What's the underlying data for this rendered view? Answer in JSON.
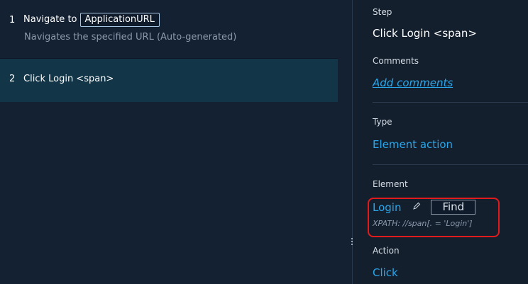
{
  "steps": [
    {
      "number": "1",
      "title": "Navigate to",
      "param": "ApplicationURL",
      "description": "Navigates the specified URL (Auto-generated)"
    },
    {
      "number": "2",
      "title": "Click Login <span>"
    }
  ],
  "details": {
    "step_label": "Step",
    "step_value": "Click Login <span>",
    "comments_label": "Comments",
    "comments_link": "Add comments",
    "type_label": "Type",
    "type_value": "Element action",
    "element_label": "Element",
    "element_name": "Login",
    "find_label": "Find",
    "xpath": "XPATH: //span[. = 'Login']",
    "action_label": "Action",
    "action_value": "Click"
  },
  "colors": {
    "accent": "#2aa7ea",
    "selected_row": "#123548",
    "highlight": "#e11b1b"
  },
  "icons": {
    "edit": "pencil-icon"
  }
}
